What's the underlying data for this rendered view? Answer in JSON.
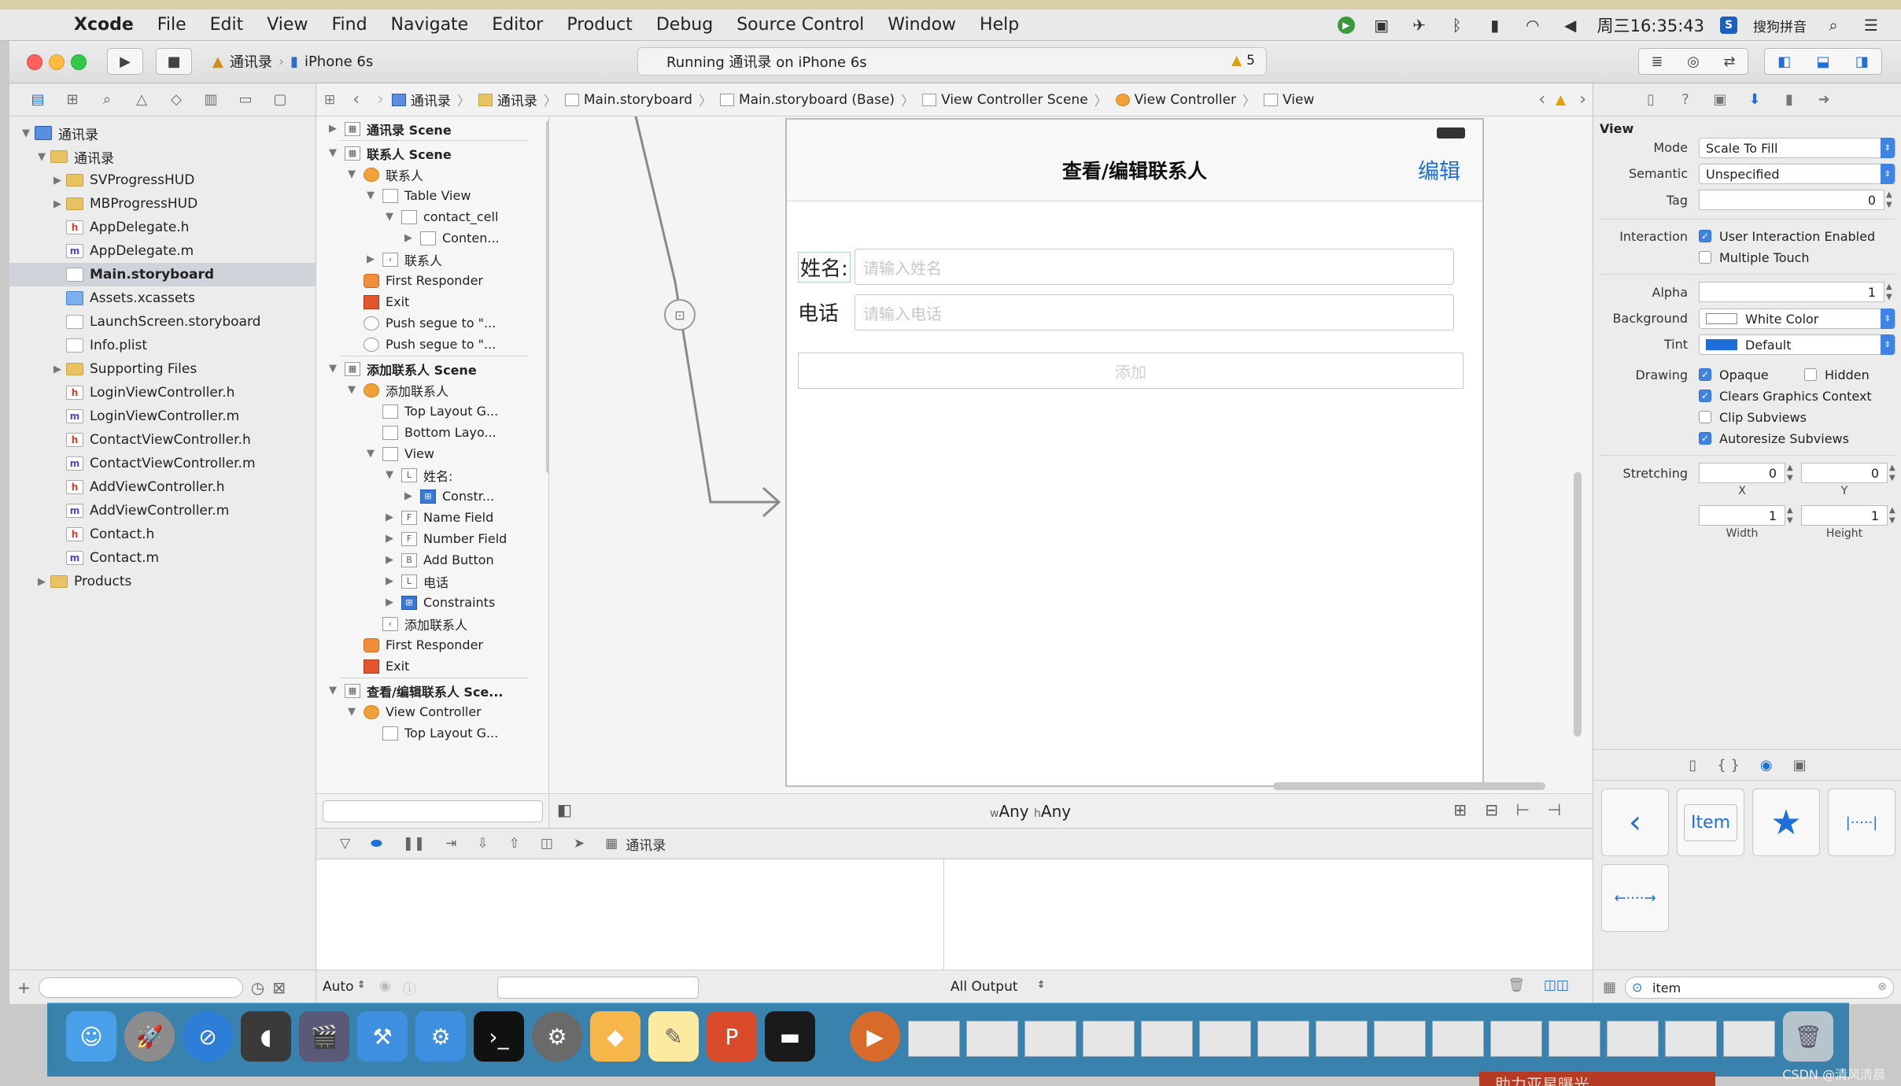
{
  "menubar": {
    "items": [
      "Xcode",
      "File",
      "Edit",
      "View",
      "Find",
      "Navigate",
      "Editor",
      "Product",
      "Debug",
      "Source Control",
      "Window",
      "Help"
    ],
    "clock": "周三16:35:43",
    "ime": "搜狗拼音"
  },
  "toolbar": {
    "scheme_target": "通讯录",
    "scheme_device": "iPhone 6s",
    "activity": "Running 通讯录 on iPhone 6s",
    "warning_count": "5"
  },
  "navigator": {
    "items": [
      {
        "label": "通讯录",
        "icon": "proj",
        "indent": 0,
        "disc": "▼"
      },
      {
        "label": "通讯录",
        "icon": "folder",
        "indent": 1,
        "disc": "▼"
      },
      {
        "label": "SVProgressHUD",
        "icon": "folder",
        "indent": 2,
        "disc": "▶"
      },
      {
        "label": "MBProgressHUD",
        "icon": "folder",
        "indent": 2,
        "disc": "▶"
      },
      {
        "label": "AppDelegate.h",
        "icon": "h",
        "indent": 2,
        "disc": ""
      },
      {
        "label": "AppDelegate.m",
        "icon": "m",
        "indent": 2,
        "disc": ""
      },
      {
        "label": "Main.storyboard",
        "icon": "sb",
        "indent": 2,
        "disc": "",
        "selected": true
      },
      {
        "label": "Assets.xcassets",
        "icon": "as",
        "indent": 2,
        "disc": ""
      },
      {
        "label": "LaunchScreen.storyboard",
        "icon": "sb",
        "indent": 2,
        "disc": ""
      },
      {
        "label": "Info.plist",
        "icon": "sb",
        "indent": 2,
        "disc": ""
      },
      {
        "label": "Supporting Files",
        "icon": "folder",
        "indent": 2,
        "disc": "▶"
      },
      {
        "label": "LoginViewController.h",
        "icon": "h",
        "indent": 2,
        "disc": ""
      },
      {
        "label": "LoginViewController.m",
        "icon": "m",
        "indent": 2,
        "disc": ""
      },
      {
        "label": "ContactViewController.h",
        "icon": "h",
        "indent": 2,
        "disc": ""
      },
      {
        "label": "ContactViewController.m",
        "icon": "m",
        "indent": 2,
        "disc": ""
      },
      {
        "label": "AddViewController.h",
        "icon": "h",
        "indent": 2,
        "disc": ""
      },
      {
        "label": "AddViewController.m",
        "icon": "m",
        "indent": 2,
        "disc": ""
      },
      {
        "label": "Contact.h",
        "icon": "h",
        "indent": 2,
        "disc": ""
      },
      {
        "label": "Contact.m",
        "icon": "m",
        "indent": 2,
        "disc": ""
      },
      {
        "label": "Products",
        "icon": "folder",
        "indent": 1,
        "disc": "▶"
      }
    ]
  },
  "jumpbar": {
    "crumbs": [
      "通讯录",
      "通讯录",
      "Main.storyboard",
      "Main.storyboard (Base)",
      "View Controller Scene",
      "View Controller",
      "View"
    ]
  },
  "outline": {
    "rows": [
      {
        "label": "通讯录 Scene",
        "indent": 0,
        "disc": "▶",
        "icon": "scene",
        "bold": true
      },
      {
        "label": "联系人 Scene",
        "indent": 0,
        "disc": "▼",
        "icon": "scene",
        "bold": true
      },
      {
        "label": "联系人",
        "indent": 1,
        "disc": "▼",
        "icon": "vc"
      },
      {
        "label": "Table View",
        "indent": 2,
        "disc": "▼",
        "icon": "box"
      },
      {
        "label": "contact_cell",
        "indent": 3,
        "disc": "▼",
        "icon": "box"
      },
      {
        "label": "Conten...",
        "indent": 4,
        "disc": "▶",
        "icon": "box"
      },
      {
        "label": "联系人",
        "indent": 2,
        "disc": "▶",
        "icon": "back"
      },
      {
        "label": "First Responder",
        "indent": 1,
        "disc": "",
        "icon": "fr"
      },
      {
        "label": "Exit",
        "indent": 1,
        "disc": "",
        "icon": "ex"
      },
      {
        "label": "Push segue to \"...",
        "indent": 1,
        "disc": "",
        "icon": "sg"
      },
      {
        "label": "Push segue to \"...",
        "indent": 1,
        "disc": "",
        "icon": "sg"
      },
      {
        "label": "添加联系人 Scene",
        "indent": 0,
        "disc": "▼",
        "icon": "scene",
        "bold": true
      },
      {
        "label": "添加联系人",
        "indent": 1,
        "disc": "▼",
        "icon": "vc"
      },
      {
        "label": "Top Layout G...",
        "indent": 2,
        "disc": "",
        "icon": "box"
      },
      {
        "label": "Bottom Layo...",
        "indent": 2,
        "disc": "",
        "icon": "box"
      },
      {
        "label": "View",
        "indent": 2,
        "disc": "▼",
        "icon": "box"
      },
      {
        "label": "姓名:",
        "indent": 3,
        "disc": "▼",
        "icon": "L"
      },
      {
        "label": "Constr...",
        "indent": 4,
        "disc": "▶",
        "icon": "bl"
      },
      {
        "label": "Name Field",
        "indent": 3,
        "disc": "▶",
        "icon": "F"
      },
      {
        "label": "Number Field",
        "indent": 3,
        "disc": "▶",
        "icon": "F"
      },
      {
        "label": "Add Button",
        "indent": 3,
        "disc": "▶",
        "icon": "B"
      },
      {
        "label": "电话",
        "indent": 3,
        "disc": "▶",
        "icon": "L"
      },
      {
        "label": "Constraints",
        "indent": 3,
        "disc": "▶",
        "icon": "bl"
      },
      {
        "label": "添加联系人",
        "indent": 2,
        "disc": "",
        "icon": "back"
      },
      {
        "label": "First Responder",
        "indent": 1,
        "disc": "",
        "icon": "fr"
      },
      {
        "label": "Exit",
        "indent": 1,
        "disc": "",
        "icon": "ex"
      },
      {
        "label": "查看/编辑联系人 Sce...",
        "indent": 0,
        "disc": "▼",
        "icon": "scene",
        "bold": true
      },
      {
        "label": "View Controller",
        "indent": 1,
        "disc": "▼",
        "icon": "vc"
      },
      {
        "label": "Top Layout G...",
        "indent": 2,
        "disc": "",
        "icon": "box"
      }
    ]
  },
  "device": {
    "nav_title": "查看/编辑联系人",
    "edit_label": "编辑",
    "name_label": "姓名:",
    "name_placeholder": "请输入姓名",
    "phone_label": "电话",
    "phone_placeholder": "请输入电话",
    "add_label": "添加"
  },
  "canvasbar": {
    "w_prefix": "w",
    "w_value": "Any",
    "h_prefix": "h",
    "h_value": "Any"
  },
  "debug": {
    "target": "通讯录",
    "auto_label": "Auto",
    "output_label": "All Output"
  },
  "inspector": {
    "section_title": "View",
    "mode_label": "Mode",
    "mode_value": "Scale To Fill",
    "semantic_label": "Semantic",
    "semantic_value": "Unspecified",
    "tag_label": "Tag",
    "tag_value": "0",
    "interaction_label": "Interaction",
    "user_interaction": "User Interaction Enabled",
    "multiple_touch": "Multiple Touch",
    "alpha_label": "Alpha",
    "alpha_value": "1",
    "background_label": "Background",
    "background_value": "White Color",
    "tint_label": "Tint",
    "tint_value": "Default",
    "drawing_label": "Drawing",
    "opaque": "Opaque",
    "hidden": "Hidden",
    "clears": "Clears Graphics Context",
    "clip": "Clip Subviews",
    "autoresize": "Autoresize Subviews",
    "stretching_label": "Stretching",
    "stretch_x": "0",
    "stretch_y": "0",
    "x_label": "X",
    "y_label": "Y",
    "stretch_w": "1",
    "stretch_h": "1",
    "width_label": "Width",
    "height_label": "Height",
    "library_item_label": "Item",
    "search_value": "item",
    "colors": {
      "accent": "#3f84e5",
      "tint_swatch": "#1e6fd9"
    }
  },
  "dock": {
    "watermark": "CSDN @清风清晨",
    "bottom_caption": "助力亚星曝光"
  }
}
